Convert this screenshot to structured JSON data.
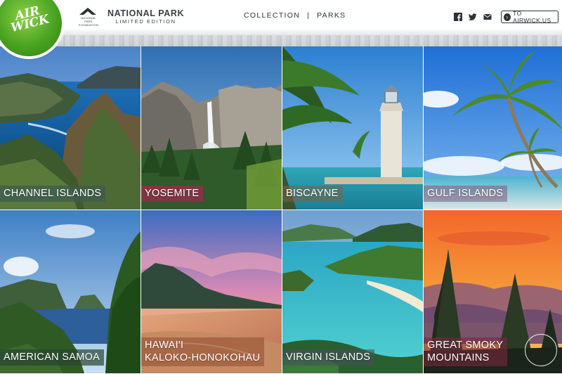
{
  "brand": {
    "logo_text": "AIR WICK",
    "foundation_text": "NATIONAL PARK FOUNDATION",
    "edition_title": "NATIONAL PARK",
    "edition_subtitle": "LIMITED EDITION"
  },
  "nav": {
    "collection": "COLLECTION",
    "separator": "|",
    "parks": "PARKS"
  },
  "social": {
    "facebook": "facebook-icon",
    "twitter": "twitter-icon",
    "email": "email-icon"
  },
  "external_link": "TO AIRWICK.US",
  "tiles": [
    {
      "label": "CHANNEL ISLANDS"
    },
    {
      "label": "YOSEMITE"
    },
    {
      "label": "BISCAYNE"
    },
    {
      "label": "GULF ISLANDS"
    },
    {
      "label": "AMERICAN SAMOA"
    },
    {
      "label_line1": "HAWAI'I",
      "label_line2": "KALOKO-HONOKOHAU"
    },
    {
      "label": "VIRGIN ISLANDS"
    },
    {
      "label_line1": "GREAT SMOKY",
      "label_line2": "MOUNTAINS"
    }
  ],
  "colors": {
    "brand_green": "#4aa321",
    "text_dark": "#2d3236"
  }
}
